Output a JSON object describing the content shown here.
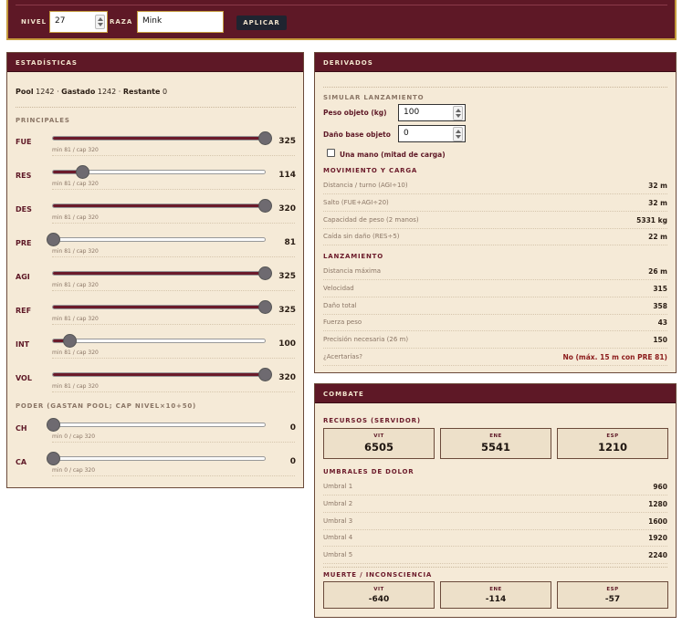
{
  "toolbar": {
    "level_label": "NIVEL",
    "level_value": "27",
    "race_label": "RAZA",
    "race_value": "Mink",
    "apply_label": "APLICAR"
  },
  "stats": {
    "title": "ESTADÍSTICAS",
    "pool": {
      "pool_label": "Pool",
      "pool_value": "1242",
      "spent_label": "Gastado",
      "spent_value": "1242",
      "rest_label": "Restante",
      "rest_value": "0",
      "sep": "·"
    },
    "principal_title": "PRINCIPALES",
    "principal": [
      {
        "label": "FUE",
        "value": "325",
        "hint": "min 81 / cap 320",
        "level": 1.0
      },
      {
        "label": "RES",
        "value": "114",
        "hint": "min 81 / cap 320",
        "level": 0.138
      },
      {
        "label": "DES",
        "value": "320",
        "hint": "min 81 / cap 320",
        "level": 1.0
      },
      {
        "label": "PRE",
        "value": "81",
        "hint": "min 81 / cap 320",
        "level": 0.0
      },
      {
        "label": "AGI",
        "value": "325",
        "hint": "min 81 / cap 320",
        "level": 1.0
      },
      {
        "label": "REF",
        "value": "325",
        "hint": "min 81 / cap 320",
        "level": 1.0
      },
      {
        "label": "INT",
        "value": "100",
        "hint": "min 81 / cap 320",
        "level": 0.079
      },
      {
        "label": "VOL",
        "value": "320",
        "hint": "min 81 / cap 320",
        "level": 1.0
      }
    ],
    "power_title": "PODER (GASTAN POOL; CAP NIVEL×10+50)",
    "power": [
      {
        "label": "CH",
        "value": "0",
        "hint": "min 0 / cap 320",
        "level": 0.0
      },
      {
        "label": "CA",
        "value": "0",
        "hint": "min 0 / cap 320",
        "level": 0.0
      }
    ]
  },
  "derived": {
    "title": "DERIVADOS",
    "sim_title": "SIMULAR LANZAMIENTO",
    "weight_label": "Peso objeto (kg)",
    "weight_value": "100",
    "damage_label": "Daño base objeto",
    "damage_value": "0",
    "one_hand_label": "Una mano (mitad de carga)",
    "one_hand_checked": false,
    "move_title": "MOVIMIENTO Y CARGA",
    "move": [
      {
        "k": "Distancia / turno (AGI÷10)",
        "v": "32 m"
      },
      {
        "k": "Salto (FUE+AGI÷20)",
        "v": "32 m"
      },
      {
        "k": "Capacidad de peso (2 manos)",
        "v": "5331 kg"
      },
      {
        "k": "Caída sin daño (RES÷5)",
        "v": "22 m"
      }
    ],
    "launch_title": "LANZAMIENTO",
    "launch": [
      {
        "k": "Distancia máxima",
        "v": "26 m"
      },
      {
        "k": "Velocidad",
        "v": "315"
      },
      {
        "k": "Daño total",
        "v": "358"
      },
      {
        "k": "Fuerza peso",
        "v": "43"
      },
      {
        "k": "Precisión necesaria (26 m)",
        "v": "150"
      },
      {
        "k": "¿Acertarías?",
        "v": "No (máx. 15 m con PRE 81)"
      }
    ]
  },
  "combat": {
    "title": "COMBATE",
    "resources_title": "RECURSOS (SERVIDOR)",
    "resources": [
      {
        "label": "VIT",
        "value": "6505"
      },
      {
        "label": "ENE",
        "value": "5541"
      },
      {
        "label": "ESP",
        "value": "1210"
      }
    ],
    "pain_title": "UMBRALES DE DOLOR",
    "pain": [
      {
        "k": "Umbral 1",
        "v": "960"
      },
      {
        "k": "Umbral 2",
        "v": "1280"
      },
      {
        "k": "Umbral 3",
        "v": "1600"
      },
      {
        "k": "Umbral 4",
        "v": "1920"
      },
      {
        "k": "Umbral 5",
        "v": "2240"
      }
    ],
    "death_title": "MUERTE / INCONSCIENCIA",
    "death": [
      {
        "label": "VIT",
        "value": "-640"
      },
      {
        "label": "ENE",
        "value": "-114"
      },
      {
        "label": "ESP",
        "value": "-57"
      }
    ]
  }
}
